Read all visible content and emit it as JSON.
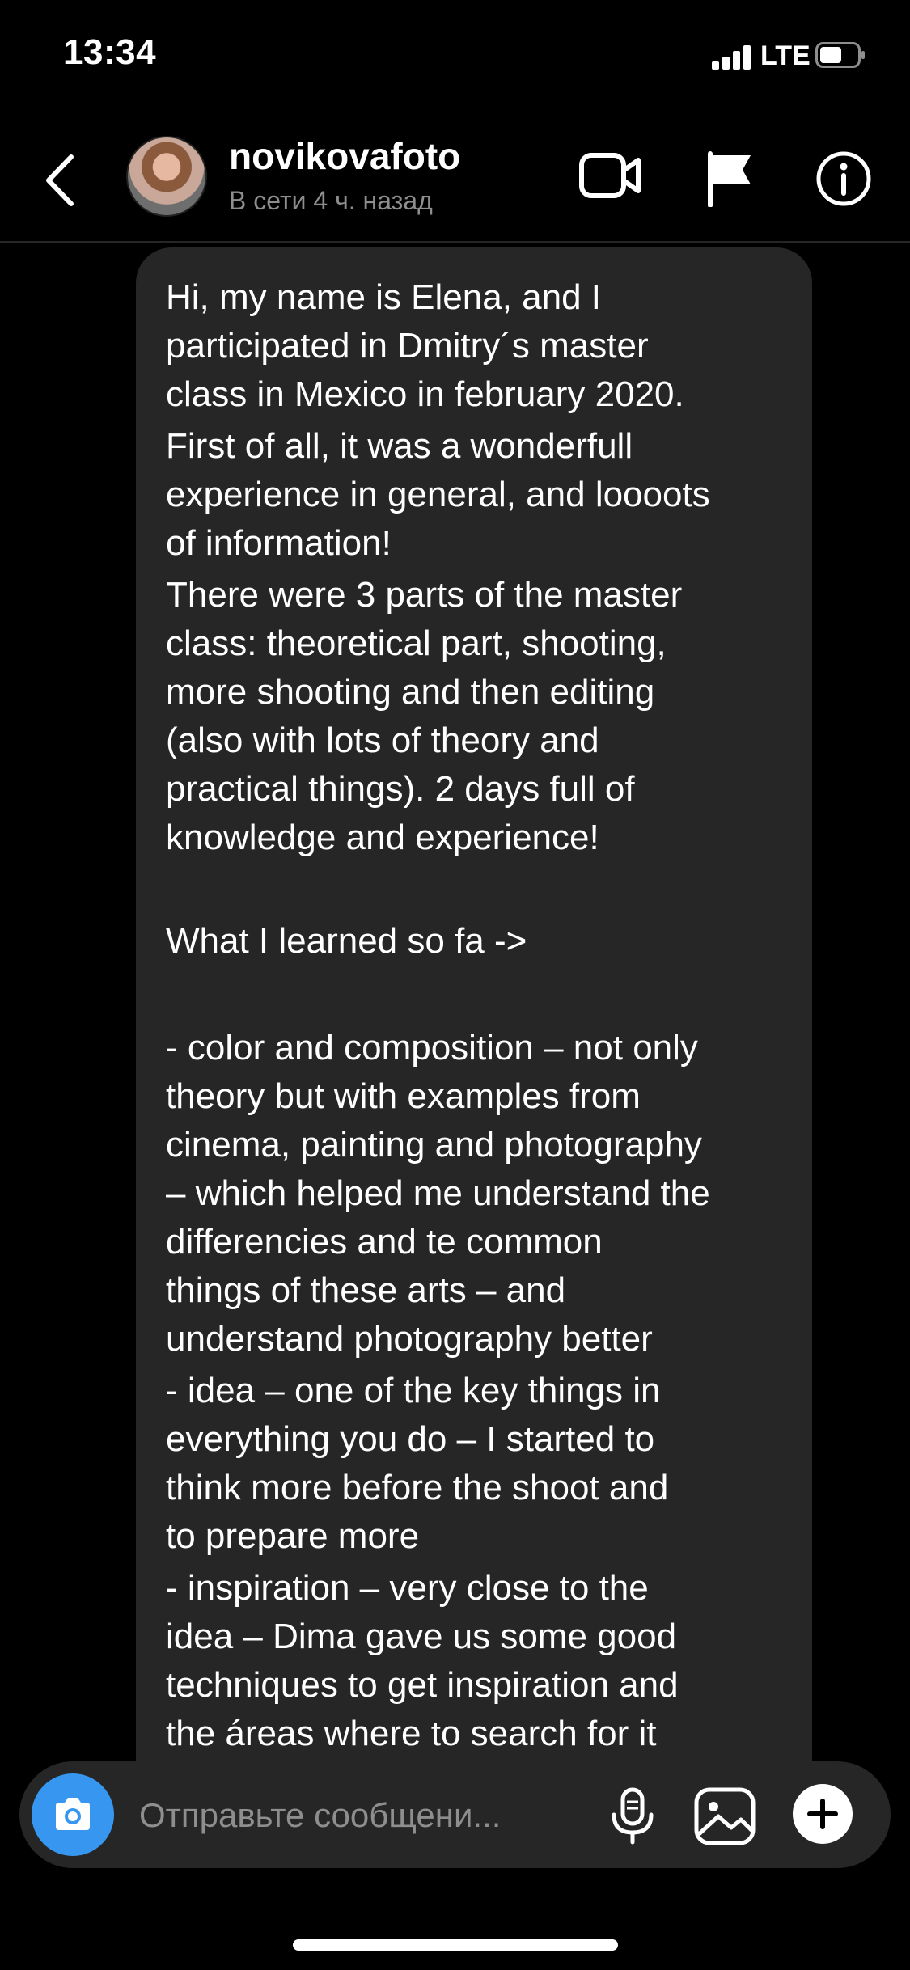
{
  "status_bar": {
    "time": "13:34",
    "network": "LTE",
    "icons": [
      "signal-icon",
      "battery-icon"
    ]
  },
  "header": {
    "username": "novikovafoto",
    "presence": "В сети 4 ч. назад",
    "icons": [
      "back-chevron-icon",
      "avatar",
      "video-call-icon",
      "flag-icon",
      "info-icon"
    ]
  },
  "message": {
    "paragraphs": [
      "Hi, my name is Elena, and I\nparticipated in Dmitry´s master\nclass in Mexico in february 2020.",
      "First of all, it was a wonderfull\nexperience in general, and loooots\nof information!",
      "There were 3 parts of the master\nclass: theoretical part, shooting,\nmore shooting and then editing\n(also with lots of theory and\npractical things). 2 days full of\nknowledge and experience!",
      "What I learned so fa ->",
      "- color and composition – not only\ntheory but with examples from\ncinema, painting and photography\n– which helped me understand the\ndifferencies and te common\nthings of these arts – and\nunderstand photography better",
      "- idea – one of the key things in\neverything you do – I started to\nthink more before the shoot and\nto prepare more",
      "- inspiration – very close to the\nidea – Dima gave us some good\ntechniques to get inspiration and\nthe áreas where to search for it"
    ]
  },
  "composer": {
    "placeholder": "Отправьте сообщени...",
    "value": "",
    "icons": [
      "camera-icon",
      "microphone-icon",
      "gallery-icon",
      "plus-icon"
    ]
  },
  "colors": {
    "background": "#000000",
    "bubble": "#262626",
    "accent": "#3797f0",
    "secondary_text": "#8e8e8e"
  }
}
